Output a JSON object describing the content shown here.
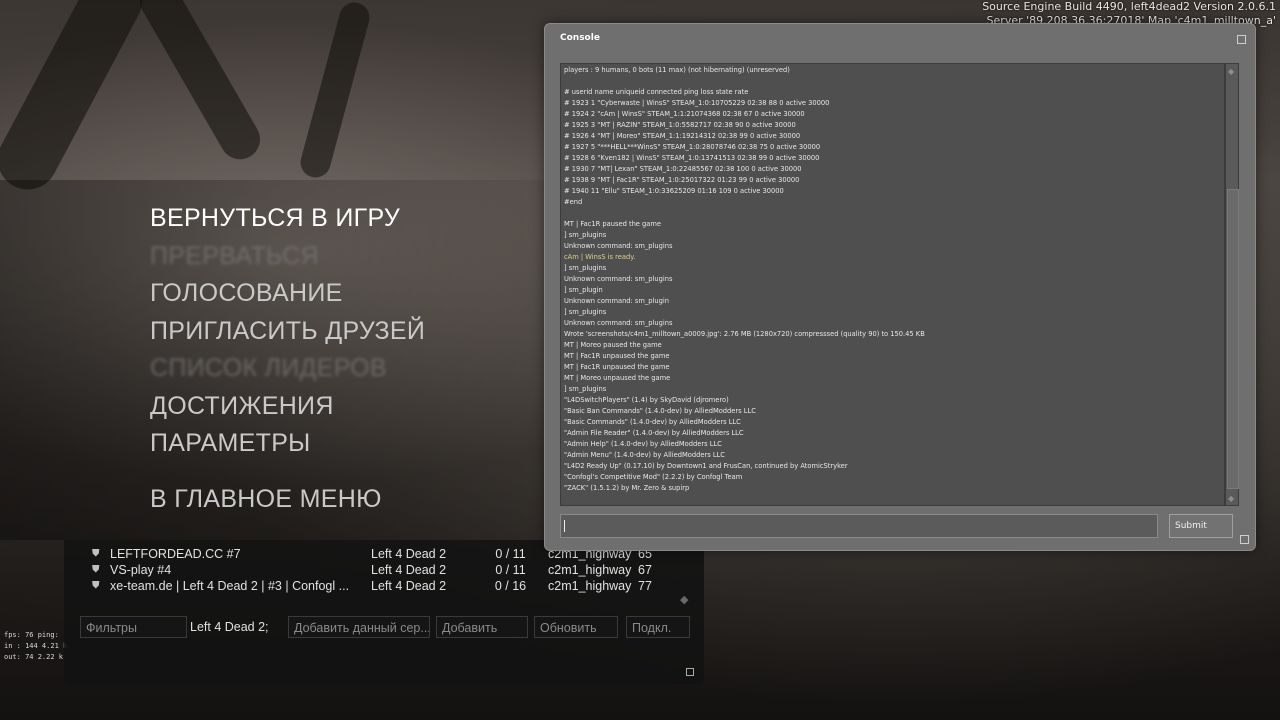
{
  "engine_info": {
    "line1": "Source Engine Build 4490, left4dead2 Version 2.0.6.1",
    "line2": "Server '89.208.36.36:27018' Map 'c4m1_milltown_a'"
  },
  "main_menu": {
    "items": [
      {
        "label": "ВЕРНУТЬСЯ В ИГРУ",
        "state": "active"
      },
      {
        "label": "ПРЕРВАТЬСЯ",
        "state": "disabled"
      },
      {
        "label": "ГОЛОСОВАНИЕ",
        "state": "normal"
      },
      {
        "label": "ПРИГЛАСИТЬ ДРУЗЕЙ",
        "state": "normal"
      },
      {
        "label": "СПИСОК ЛИДЕРОВ",
        "state": "disabled"
      },
      {
        "label": "ДОСТИЖЕНИЯ",
        "state": "normal"
      },
      {
        "label": "ПАРАМЕТРЫ",
        "state": "normal"
      },
      {
        "label": "В ГЛАВНОЕ МЕНЮ",
        "state": "normal"
      }
    ]
  },
  "netgraph": {
    "line1": "fps:  76   ping: ",
    "line2": "in :  144    4.21 k",
    "line3": "out:  74    2.22 k"
  },
  "server_browser": {
    "rows": [
      {
        "name": "LEFTFORDEAD.CC #7",
        "game": "Left 4 Dead 2",
        "players": "0 / 11",
        "map": "c2m1_highway",
        "ping": "65"
      },
      {
        "name": "VS-play #4",
        "game": "Left 4 Dead 2",
        "players": "0 / 11",
        "map": "c2m1_highway",
        "ping": "67"
      },
      {
        "name": "xe-team.de | Left 4 Dead 2 | #3 | Confogl ...",
        "game": "Left 4 Dead 2",
        "players": "0 / 16",
        "map": "c2m1_highway",
        "ping": "77"
      }
    ],
    "filters_label": "Фильтры",
    "filter_value": "Left 4 Dead 2;",
    "add_current_label": "Добавить данный сер...",
    "add_label": "Добавить",
    "refresh_label": "Обновить",
    "connect_label": "Подкл."
  },
  "console": {
    "title": "Console",
    "submit_label": "Submit",
    "input_value": "",
    "lines": [
      {
        "text": "players : 9 humans, 0 bots (11 max) (not hibernating) (unreserved)"
      },
      {
        "text": ""
      },
      {
        "text": "# userid name uniqueid connected ping loss state rate"
      },
      {
        "text": "# 1923 1 \"Cyberwaste | WinsS\" STEAM_1:0:10705229 02:38 88 0 active 30000"
      },
      {
        "text": "# 1924 2 \"cAm | WinsS\" STEAM_1:1:21074368 02:38 67 0 active 30000"
      },
      {
        "text": "# 1925 3 \"MT | RAZIN\" STEAM_1:0:5582717 02:38 90 0 active 30000"
      },
      {
        "text": "# 1926 4 \"MT | Moreo\" STEAM_1:1:19214312 02:38 99 0 active 30000"
      },
      {
        "text": "# 1927 5 \"***HELL***WinsS\" STEAM_1:0:28078746 02:38 75 0 active 30000"
      },
      {
        "text": "# 1928 6 \"Kven182 | WinsS\" STEAM_1:0:13741513 02:38 99 0 active 30000"
      },
      {
        "text": "# 1930 7 \"MT| Lexan\" STEAM_1:0:22485567 02:38 100 0 active 30000"
      },
      {
        "text": "# 1938 9 \"MT | Fac1R\" STEAM_1:0:25017322 01:23 99 0 active 30000"
      },
      {
        "text": "# 1940 11 \"Ellu\" STEAM_1:0:33625209 01:16 109 0 active 30000"
      },
      {
        "text": "#end"
      },
      {
        "text": ""
      },
      {
        "text": "MT | Fac1R paused the game"
      },
      {
        "text": "] sm_plugins"
      },
      {
        "text": "Unknown command: sm_plugins"
      },
      {
        "text": "cAm | WinsS is ready.",
        "color": "yellow"
      },
      {
        "text": "] sm_plugins"
      },
      {
        "text": "Unknown command: sm_plugins"
      },
      {
        "text": "] sm_plugin"
      },
      {
        "text": "Unknown command: sm_plugin"
      },
      {
        "text": "] sm_plugins"
      },
      {
        "text": "Unknown command: sm_plugins"
      },
      {
        "text": "Wrote 'screenshots/c4m1_milltown_a0009.jpg': 2.76 MB (1280x720) compresssed (quality 90) to 150.45 KB"
      },
      {
        "text": "MT | Moreo paused the game"
      },
      {
        "text": "MT | Fac1R unpaused the game"
      },
      {
        "text": "MT | Fac1R unpaused the game"
      },
      {
        "text": "MT | Moreo unpaused the game"
      },
      {
        "text": "] sm_plugins"
      },
      {
        "text": "\"L4DSwitchPlayers\" (1.4) by SkyDavid (djromero)"
      },
      {
        "text": "\"Basic Ban Commands\" (1.4.0-dev) by AlliedModders LLC"
      },
      {
        "text": "\"Basic Commands\" (1.4.0-dev) by AlliedModders LLC"
      },
      {
        "text": "\"Admin File Reader\" (1.4.0-dev) by AlliedModders LLC"
      },
      {
        "text": "\"Admin Help\" (1.4.0-dev) by AlliedModders LLC"
      },
      {
        "text": "\"Admin Menu\" (1.4.0-dev) by AlliedModders LLC"
      },
      {
        "text": "\"L4D2 Ready Up\" (0.17.10) by Downtown1 and FrusCan, continued by AtomicStryker"
      },
      {
        "text": "\"Confogl's Competitive Mod\" (2.2.2) by Confogl Team"
      },
      {
        "text": "\"ZACK\" (1.5.1.2) by Mr. Zero & supirp"
      }
    ]
  }
}
